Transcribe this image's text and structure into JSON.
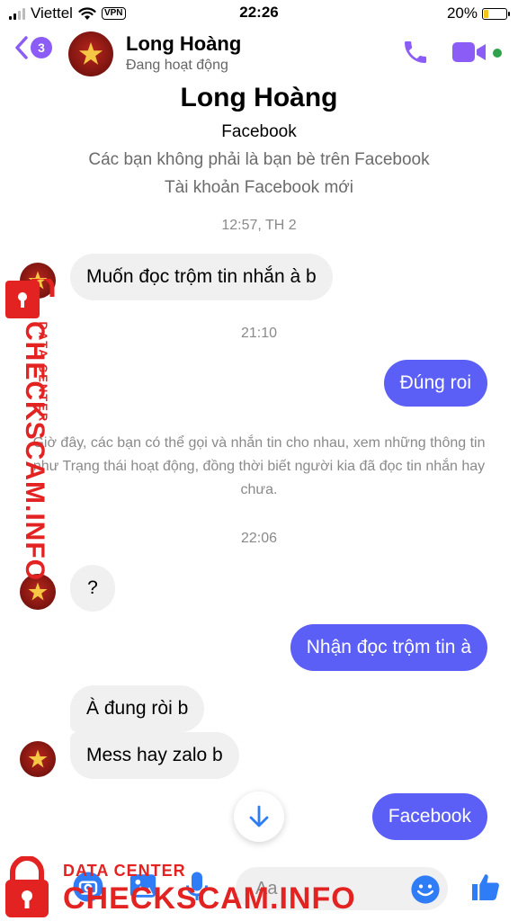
{
  "status_bar": {
    "carrier": "Viettel",
    "vpn": "VPN",
    "time": "22:26",
    "battery": "20%",
    "battery_level": 0.2
  },
  "header": {
    "back_count": "3",
    "contact_name": "Long Hoàng",
    "contact_status": "Đang hoạt động"
  },
  "intro": {
    "name": "Long Hoàng",
    "network": "Facebook",
    "line1": "Các bạn không phải là bạn bè trên Facebook",
    "line2": "Tài khoản Facebook mới"
  },
  "timestamps": [
    "12:57, TH 2",
    "21:10",
    "22:06"
  ],
  "messages": [
    {
      "direction": "in",
      "text": "Muốn đọc trộm tin nhắn à b"
    },
    {
      "direction": "out",
      "text": "Đúng roi"
    },
    {
      "direction": "in",
      "text": "?"
    },
    {
      "direction": "out",
      "text": "Nhận đọc trộm tin à"
    },
    {
      "direction": "in",
      "text": "À đung ròi b"
    },
    {
      "direction": "in",
      "text": "Mess hay zalo b"
    },
    {
      "direction": "out",
      "text": "Facebook"
    }
  ],
  "system_note": "Giờ đây, các bạn có thể gọi và nhắn tin cho nhau, xem những thông tin như Trạng thái hoạt động, đồng thời biết người kia đã đọc tin nhắn hay chưa.",
  "composer": {
    "placeholder": "Aa"
  },
  "watermark": {
    "line1": "DATA CENTER",
    "line2": "CHECKSCAM.INFO"
  },
  "colors": {
    "accent": "#5b5ff5",
    "header_icons": "#8b5cf6",
    "online": "#31a24c",
    "like": "#2e7cf6",
    "watermark": "#e32222"
  }
}
